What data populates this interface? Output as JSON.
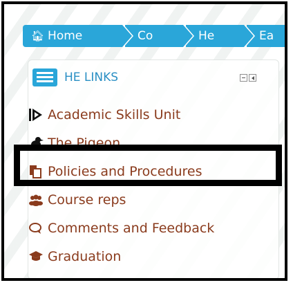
{
  "breadcrumb": {
    "items": [
      {
        "label": "Home",
        "icon": "home-icon"
      },
      {
        "label": "Co"
      },
      {
        "label": "He"
      },
      {
        "label": "Ea"
      }
    ],
    "color": "#2aa6d9"
  },
  "block": {
    "title": "HE LINKS",
    "title_icon": "list-icon",
    "controls": [
      "minimize-icon",
      "dock-icon"
    ],
    "links": [
      {
        "label": "Academic Skills Unit",
        "icon": "play-flag-icon"
      },
      {
        "label": "The Pigeon",
        "icon": "pigeon-icon"
      },
      {
        "label": "Policies and Procedures",
        "icon": "documents-icon",
        "highlighted": true
      },
      {
        "label": "Course reps",
        "icon": "users-icon"
      },
      {
        "label": "Comments and Feedback",
        "icon": "comments-icon"
      },
      {
        "label": "Graduation",
        "icon": "graduation-cap-icon"
      }
    ],
    "link_color": "#8a3b1d",
    "title_color": "#2a8fc4"
  }
}
